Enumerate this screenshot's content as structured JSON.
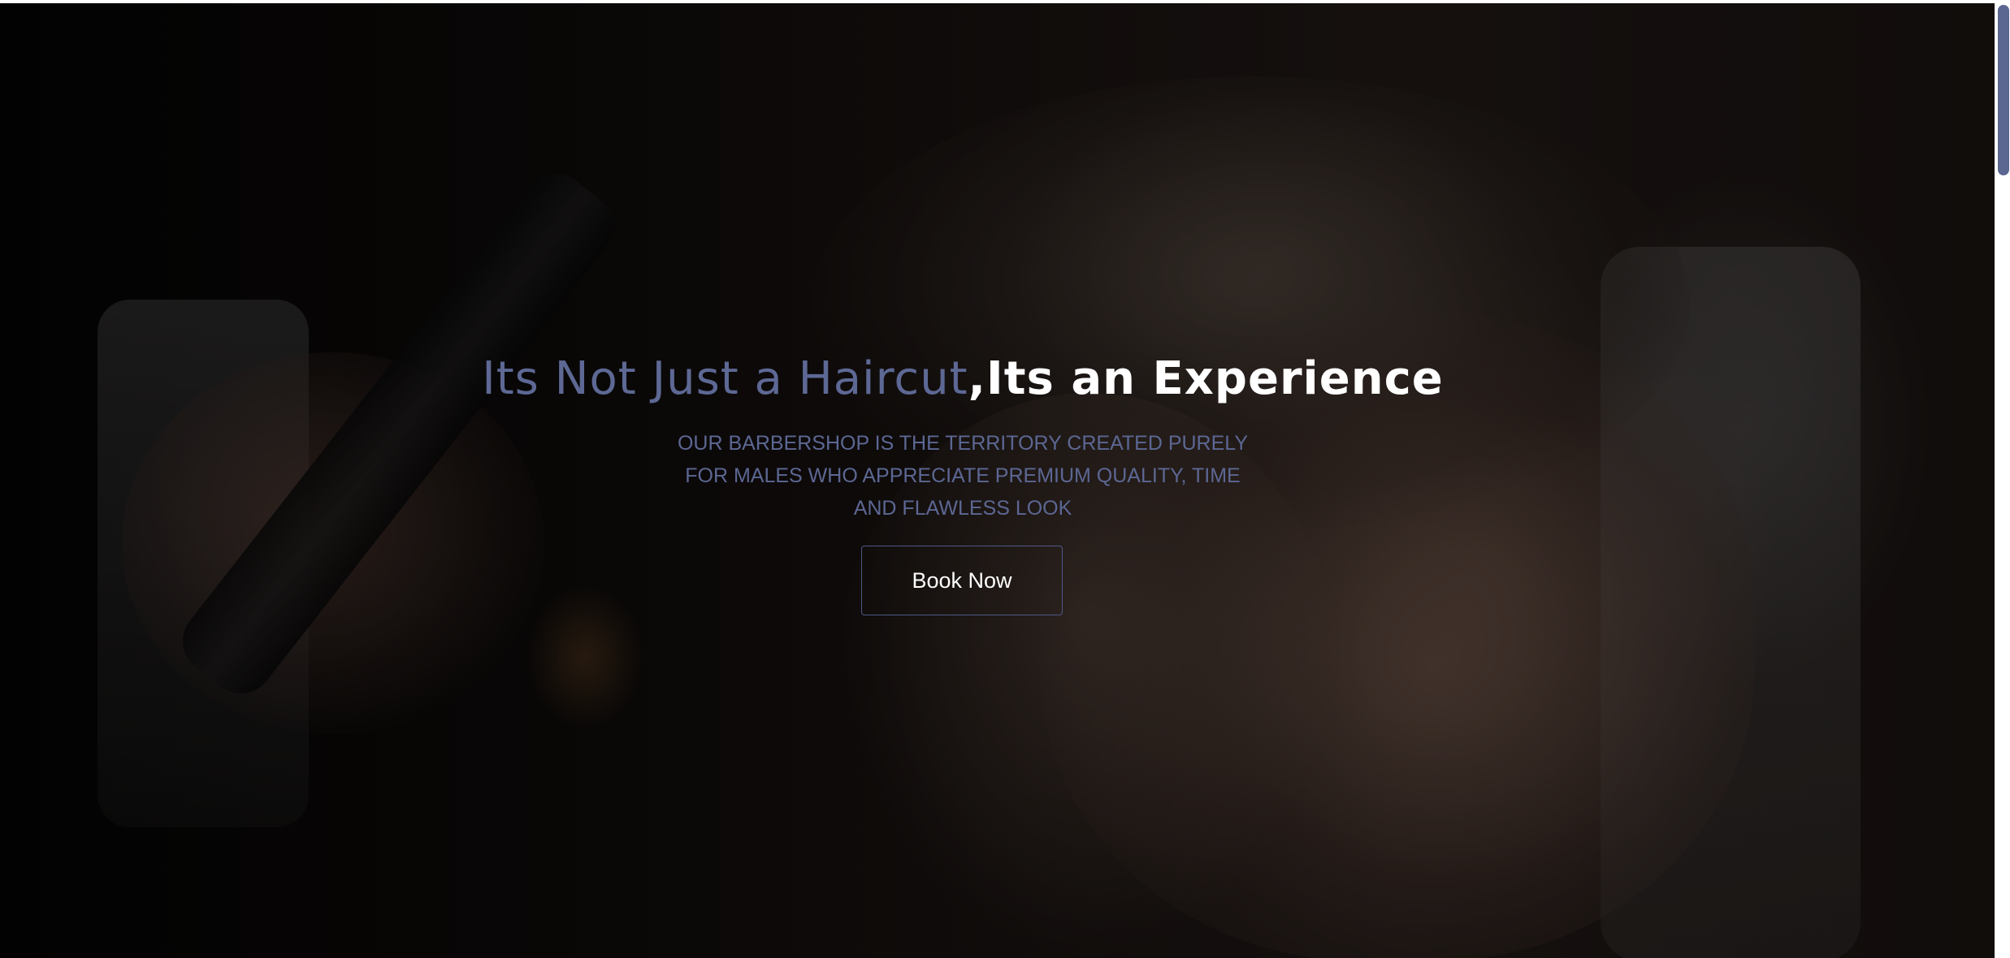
{
  "hero": {
    "headline_part1": "Its Not Just a Haircut",
    "headline_part2": ",Its an Experience",
    "subtitle": "OUR BARBERSHOP IS THE TERRITORY CREATED PURELY FOR MALES WHO APPRECIATE PREMIUM QUALITY, TIME AND FLAWLESS LOOK",
    "book_button_label": "Book Now",
    "background_image": "barber-cutting-hair-photo"
  },
  "colors": {
    "accent": "#5d6894",
    "headline_highlight": "#ffffff",
    "scrollbar_thumb": "#5b6790"
  },
  "scrollbar": {
    "position": 0
  }
}
